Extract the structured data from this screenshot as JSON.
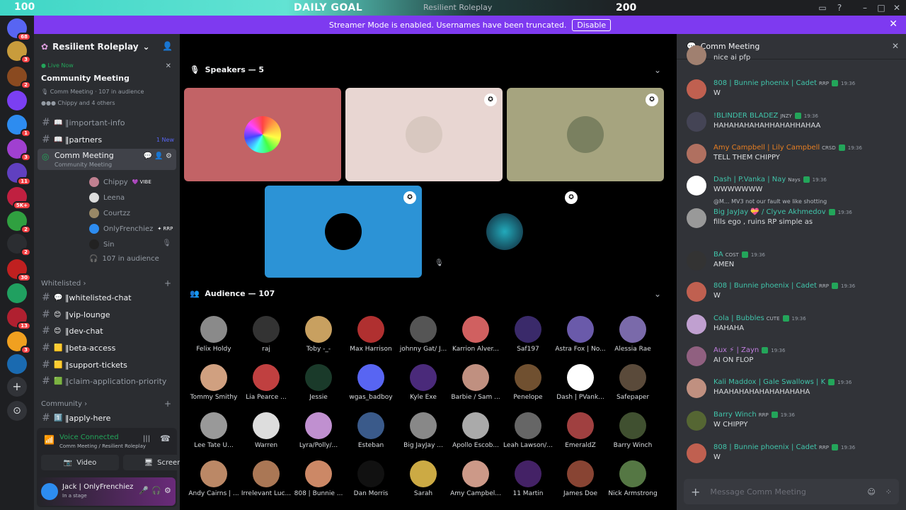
{
  "goal": {
    "left_value": "100",
    "title": "DAILY GOAL",
    "right_value": "200"
  },
  "app_title": "Resilient Roleplay",
  "banner": {
    "text": "Streamer Mode is enabled. Usernames have been truncated.",
    "button": "Disable"
  },
  "server_rail": {
    "badges": [
      "68",
      "3",
      "2",
      "",
      "1",
      "3",
      "11",
      "5K+",
      "2",
      "2",
      "",
      "30",
      "",
      "13",
      "3",
      ""
    ]
  },
  "sidebar": {
    "server_name": "Resilient Roleplay",
    "live": {
      "label": "Live Now",
      "title": "Community Meeting",
      "meta_channel": "Comm Meeting",
      "meta_audience": "107 in audience",
      "participants": "Chippy and 4 others"
    },
    "channels_top": [
      {
        "emoji": "📖",
        "name": "important-info",
        "badge": ""
      },
      {
        "emoji": "📖",
        "name": "partners",
        "badge": "1 New"
      }
    ],
    "stage": {
      "name": "Comm Meeting",
      "sub": "Community Meeting"
    },
    "members": [
      {
        "name": "Chippy",
        "tag": "VIBE"
      },
      {
        "name": "Leena",
        "tag": ""
      },
      {
        "name": "Courtzz",
        "tag": ""
      },
      {
        "name": "OnlyFrenchiez",
        "tag": "RRP"
      },
      {
        "name": "Sin",
        "tag": ""
      }
    ],
    "audience_count": "107 in audience",
    "category_whitelisted": "Whitelisted",
    "channels_whitelisted": [
      {
        "emoji": "💬",
        "name": "whitelisted-chat"
      },
      {
        "emoji": "😊",
        "name": "vip-lounge"
      },
      {
        "emoji": "😊",
        "name": "dev-chat"
      },
      {
        "emoji": "🟨",
        "name": "beta-access"
      },
      {
        "emoji": "🟨",
        "name": "support-tickets"
      },
      {
        "emoji": "🟩",
        "name": "claim-application-priority"
      }
    ],
    "category_community": "Community",
    "channels_community": [
      {
        "emoji": "1️⃣",
        "name": "apply-here"
      }
    ],
    "voice": {
      "status": "Voice Connected",
      "location": "Comm Meeting / Resilient Roleplay",
      "video": "Video",
      "screen": "Screen"
    },
    "user": {
      "name": "Jack | OnlyFrenchiez",
      "status": "In a stage"
    }
  },
  "main": {
    "speakers_label": "Speakers — 5",
    "audience_label": "Audience — 107",
    "speaker_colors": [
      "#c26366",
      "#e8d6d2",
      "#a6a47f",
      "#2c93d6",
      "#000000"
    ],
    "audience": [
      "Felix Holdy",
      "raj",
      "Toby -_-",
      "Max Harrison",
      "johnny Gat/ J...",
      "Karrion Alver...",
      "Saf197",
      "Astra Fox | No...",
      "Alessia Rae",
      "Tommy Smithy",
      "Lia Pearce ...",
      "Jessie",
      "wgas_badboy",
      "Kyle Exe",
      "Barbie / Sam ...",
      "Penelope",
      "Dash | PVank...",
      "Safepaper",
      "Lee Tate U...",
      "Warren",
      "Lyra/Polly/...",
      "Esteban",
      "Big JayJay ...",
      "Apollo Escob...",
      "Leah Lawson/...",
      "EmeraldZ",
      "Barry Winch",
      "Andy Cairns | ...",
      "Irrelevant Luc...",
      "808 | Bunnie ...",
      "Dan Morris",
      "Sarah",
      "Amy Campbel...",
      "11 Martin",
      "James Doe",
      "Nick Armstrong"
    ],
    "audience_colors": [
      "#8a8a8a",
      "#333",
      "#c8a060",
      "#b03030",
      "#555",
      "#d06060",
      "#3a2a6a",
      "#6a5aaa",
      "#7a6aaa",
      "#d0a080",
      "#c04040",
      "#1a3a2a",
      "#5865f2",
      "#4a2a7a",
      "#c09080",
      "#705030",
      "#fff",
      "#5a4a3a",
      "#999",
      "#ddd",
      "#c090d0",
      "#3a5a8a",
      "#888",
      "#aaa",
      "#666",
      "#a04040",
      "#405030",
      "#bb8866",
      "#aa7755",
      "#cc8866",
      "#111",
      "#ccaa44",
      "#cc9988",
      "#442266",
      "#884433",
      "#557744"
    ]
  },
  "chat": {
    "header": "Comm Meeting",
    "input_placeholder": "Message Comm Meeting",
    "messages": [
      {
        "name": "",
        "tag": "",
        "time": "",
        "text": "nice ai pfp",
        "color": "#f2f3f5"
      },
      {
        "name": "808 | Bunnie phoenix | Cadet",
        "tag": "RRP",
        "time": "19:36",
        "text": "W",
        "color": "#40c4aa"
      },
      {
        "name": "!BLINDER BLADEZ",
        "tag": "JNZY",
        "time": "19:36",
        "text": "HAHAHAHAHAHHAHAHHAHAA",
        "color": "#40c4aa"
      },
      {
        "name": "Amy Campbell | Lily Campbell",
        "tag": "CRSD",
        "time": "19:36",
        "text": "TELL THEM CHIPPY",
        "color": "#e67e22"
      },
      {
        "name": "Dash | P.Vanka | Nay",
        "tag": "Nays",
        "time": "19:36",
        "text": "WWWWWWW",
        "color": "#40c4aa"
      },
      {
        "name": "Big JayJay 💝 / Clyve Akhmedov",
        "tag": "",
        "time": "19:36",
        "text": "fills ego , ruins RP simple as",
        "color": "#40c4aa",
        "reply": "@M... MV3 not our fault we like shotting"
      },
      {
        "name": "BA",
        "tag": "COST",
        "time": "19:36",
        "text": "AMEN",
        "color": "#40c4aa"
      },
      {
        "name": "808 | Bunnie phoenix | Cadet",
        "tag": "RRP",
        "time": "19:36",
        "text": "W",
        "color": "#40c4aa"
      },
      {
        "name": "Cola | Bubbles",
        "tag": "CUTE",
        "time": "19:36",
        "text": "HAHAHA",
        "color": "#40c4aa"
      },
      {
        "name": "Aux ⚡ | Zayn",
        "tag": "",
        "time": "19:36",
        "text": "AI ON FLOP",
        "color": "#c17ee0"
      },
      {
        "name": "Kali Maddox | Gale Swallows | K",
        "tag": "",
        "time": "19:36",
        "text": "HAAHAHAHAHAHAHAHAHA",
        "color": "#40c4aa"
      },
      {
        "name": "Barry Winch",
        "tag": "RRP",
        "time": "19:36",
        "text": "W CHIPPY",
        "color": "#40c4aa"
      },
      {
        "name": "808 | Bunnie phoenix | Cadet",
        "tag": "RRP",
        "time": "19:36",
        "text": "W",
        "color": "#40c4aa"
      }
    ]
  }
}
